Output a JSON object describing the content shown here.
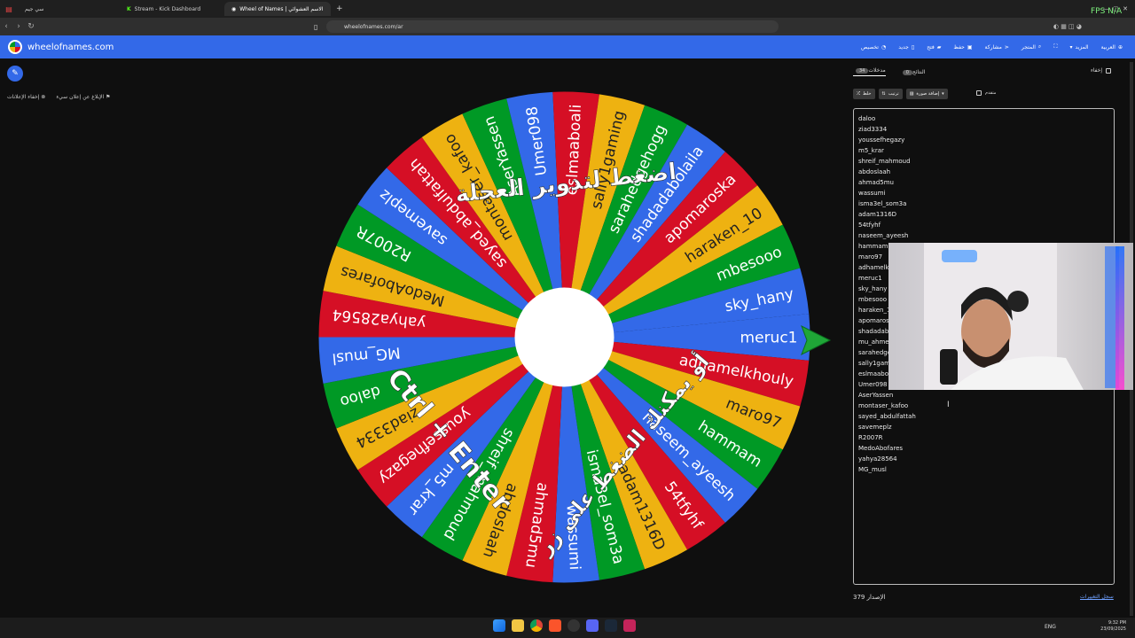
{
  "browser": {
    "tabs": [
      {
        "label": "سي جيم",
        "active": false
      },
      {
        "label": "Stream - Kick Dashboard",
        "active": false
      },
      {
        "label": "Wheel of Names | الاسم العشوائي",
        "active": true
      }
    ],
    "new_tab": "+",
    "url": "wheelofnames.com/ar",
    "overlay": "FPS N/A"
  },
  "site": {
    "name": "wheelofnames.com",
    "menu": [
      "العربية",
      "المزيد",
      "",
      "المتجر",
      "مشاركة",
      "حفظ",
      "فتح",
      "جديد",
      "تخصيص"
    ]
  },
  "ads": {
    "report": "الإبلاغ عن إعلان سيء",
    "hide": "إخفاء الإعلانات"
  },
  "wheel": {
    "colors": [
      "#3369e8",
      "#d50f25",
      "#eeb211",
      "#009925"
    ],
    "overlay_text_top": "اضغط لتدوير العجلة",
    "overlay_text_ctrl": "Ctrl + Enter",
    "overlay_text_or": "أو يمكنك الضغط على زر",
    "labels": [
      "meruc1",
      "adhamelkhouly",
      "maro97",
      "hammam",
      "naseem_ayeesh",
      "54tfyhf",
      "adam1316D",
      "isma3el_som3a",
      "wassumi",
      "ahmad5mu",
      "abdoslaah",
      "shreif_mahmoud",
      "m5_krar",
      "youssefhegazy",
      "ziad3334",
      "daloo",
      "MG_musl",
      "yahya28564",
      "MedoAbofares",
      "R2007R",
      "savemeplz",
      "sayed_abdulfattah",
      "montaser_kafoo",
      "AserYassen",
      "Umer098",
      "eslmaaboali",
      "sally1gaming",
      "sarahedgehogg",
      "shadadabolaila",
      "apomaroska",
      "haraken_10",
      "mbesooo",
      "sky_hany"
    ]
  },
  "sidebar": {
    "tab_entries": "مدخلات",
    "entries_count": "34",
    "tab_results": "النتائج",
    "results_count": "0",
    "hide_label": "إخفاء",
    "shuffle": "خلط",
    "sort": "ترتيب",
    "add_image": "إضافة صورة",
    "advanced": "متقدم",
    "entries": [
      "daloo",
      "ziad3334",
      "youssefhegazy",
      "m5_krar",
      "shreif_mahmoud",
      "abdoslaah",
      "ahmad5mu",
      "wassumi",
      "isma3el_som3a",
      "adam1316D",
      "54tfyhf",
      "naseem_ayeesh",
      "hammam",
      "maro97",
      "adhamelkhouly",
      "meruc1",
      "sky_hany",
      "mbesooo",
      "haraken_10",
      "apomaroska",
      "shadadabolaila",
      "mu_ahmed",
      "sarahedgehogg",
      "sally1gaming",
      "eslmaaboali",
      "Umer098",
      "AserYassen",
      "montaser_kafoo",
      "sayed_abdulfattah",
      "savemeplz",
      "R2007R",
      "MedoAbofares",
      "yahya28564",
      "MG_musl"
    ],
    "version_count": "379",
    "version_label": "الإصدار",
    "history_link": "سجل التغييرات"
  },
  "taskbar": {
    "lang": "ENG",
    "time": "9:32 PM",
    "date": "23/09/2025"
  }
}
